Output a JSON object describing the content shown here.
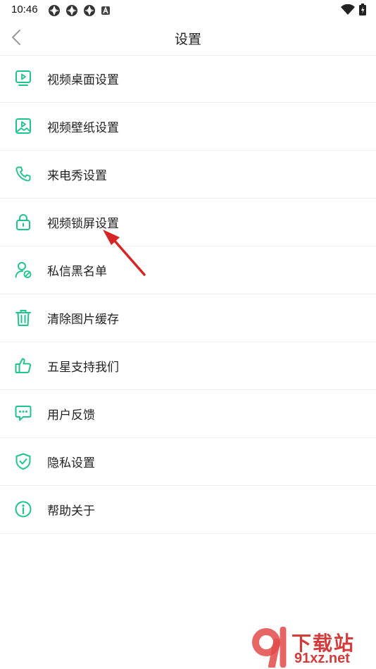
{
  "status_bar": {
    "time": "10:46"
  },
  "header": {
    "title": "设置"
  },
  "accent_color": "#1fc48c",
  "menu": [
    {
      "label": "视频桌面设置",
      "icon": "video-desktop-icon"
    },
    {
      "label": "视频壁纸设置",
      "icon": "video-wallpaper-icon"
    },
    {
      "label": "来电秀设置",
      "icon": "phone-icon"
    },
    {
      "label": "视频锁屏设置",
      "icon": "lock-icon"
    },
    {
      "label": "私信黑名单",
      "icon": "user-block-icon"
    },
    {
      "label": "清除图片缓存",
      "icon": "trash-icon"
    },
    {
      "label": "五星支持我们",
      "icon": "thumbs-up-icon"
    },
    {
      "label": "用户反馈",
      "icon": "chat-bubble-icon"
    },
    {
      "label": "隐私设置",
      "icon": "shield-check-icon"
    },
    {
      "label": "帮助关于",
      "icon": "info-icon"
    }
  ],
  "watermark": {
    "line1": "下载站",
    "line2": "91xz.net"
  }
}
